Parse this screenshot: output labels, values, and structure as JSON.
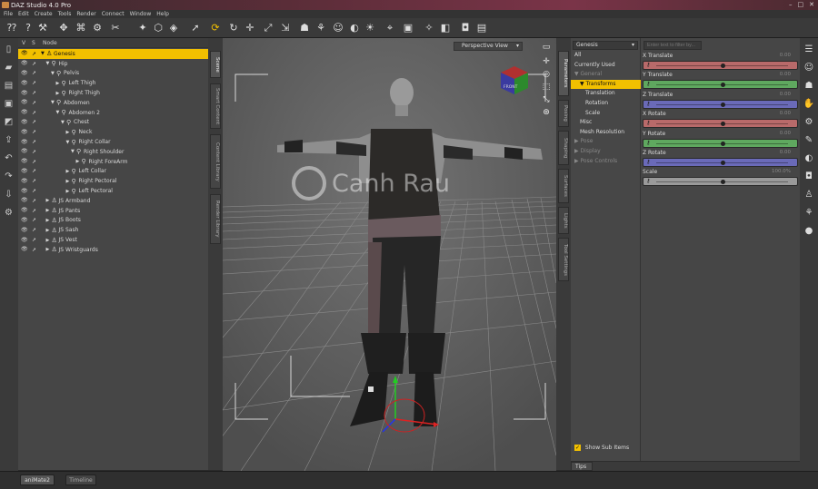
{
  "window": {
    "title": "DAZ Studio 4.0 Pro",
    "controls": [
      "–",
      "□",
      "✕"
    ]
  },
  "menu": [
    "File",
    "Edit",
    "Create",
    "Tools",
    "Render",
    "Connect",
    "Window",
    "Help"
  ],
  "scene": {
    "columns": {
      "v": "V",
      "s": "S",
      "node": "Node"
    },
    "tree": [
      {
        "label": "Genesis",
        "depth": 0,
        "selected": true,
        "type": "figure",
        "expanded": true
      },
      {
        "label": "Hip",
        "depth": 1,
        "type": "bone",
        "expanded": true
      },
      {
        "label": "Pelvis",
        "depth": 2,
        "type": "bone",
        "expanded": true
      },
      {
        "label": "Left Thigh",
        "depth": 3,
        "type": "bone",
        "expanded": false
      },
      {
        "label": "Right Thigh",
        "depth": 3,
        "type": "bone",
        "expanded": false
      },
      {
        "label": "Abdomen",
        "depth": 2,
        "type": "bone",
        "expanded": true
      },
      {
        "label": "Abdomen 2",
        "depth": 3,
        "type": "bone",
        "expanded": true
      },
      {
        "label": "Chest",
        "depth": 4,
        "type": "bone",
        "expanded": true
      },
      {
        "label": "Neck",
        "depth": 5,
        "type": "bone",
        "expanded": false
      },
      {
        "label": "Right Collar",
        "depth": 5,
        "type": "bone",
        "expanded": true
      },
      {
        "label": "Right Shoulder",
        "depth": 6,
        "type": "bone",
        "expanded": true
      },
      {
        "label": "Right ForeArm",
        "depth": 7,
        "type": "bone",
        "expanded": false
      },
      {
        "label": "Left Collar",
        "depth": 5,
        "type": "bone",
        "expanded": false
      },
      {
        "label": "Right Pectoral",
        "depth": 5,
        "type": "bone",
        "expanded": false
      },
      {
        "label": "Left Pectoral",
        "depth": 5,
        "type": "bone",
        "expanded": false
      },
      {
        "label": "JS Armband",
        "depth": 1,
        "type": "figure",
        "expanded": false
      },
      {
        "label": "JS Pants",
        "depth": 1,
        "type": "figure",
        "expanded": false
      },
      {
        "label": "JS Boots",
        "depth": 1,
        "type": "figure",
        "expanded": false
      },
      {
        "label": "JS Sash",
        "depth": 1,
        "type": "figure",
        "expanded": false
      },
      {
        "label": "JS Vest",
        "depth": 1,
        "type": "figure",
        "expanded": false
      },
      {
        "label": "JS Wristguards",
        "depth": 1,
        "type": "figure",
        "expanded": false
      }
    ]
  },
  "scene_tabs": [
    "Scene",
    "Smart Content",
    "Content Library",
    "Render Library"
  ],
  "viewport": {
    "camera": "Perspective View",
    "cube_label": "FRONT"
  },
  "param_tabs": [
    "Parameters",
    "Posing",
    "Shaping",
    "Surfaces",
    "Lights",
    "Tool Settings"
  ],
  "parameters": {
    "node_select": "Genesis",
    "filter_placeholder": "Enter text to filter by...",
    "tree": [
      {
        "label": "All",
        "indent": 0,
        "state": "normal"
      },
      {
        "label": "Currently Used",
        "indent": 0,
        "state": "normal"
      },
      {
        "label": "General",
        "indent": 0,
        "state": "dim",
        "arrow": "▼"
      },
      {
        "label": "Transforms",
        "indent": 1,
        "state": "selected",
        "arrow": "▼"
      },
      {
        "label": "Translation",
        "indent": 2,
        "state": "normal"
      },
      {
        "label": "Rotation",
        "indent": 2,
        "state": "normal"
      },
      {
        "label": "Scale",
        "indent": 2,
        "state": "normal"
      },
      {
        "label": "Misc",
        "indent": 1,
        "state": "normal"
      },
      {
        "label": "Mesh Resolution",
        "indent": 1,
        "state": "normal"
      },
      {
        "label": "Pose",
        "indent": 0,
        "state": "dim",
        "arrow": "▶"
      },
      {
        "label": "Display",
        "indent": 0,
        "state": "dim",
        "arrow": "▶"
      },
      {
        "label": "Pose Controls",
        "indent": 0,
        "state": "dim",
        "arrow": "▶"
      }
    ],
    "show_sub_items": "Show Sub Items",
    "sliders": [
      {
        "label": "X Translate",
        "value": "0.00",
        "color": "#b86a6a",
        "fill": 0.5
      },
      {
        "label": "Y Translate",
        "value": "0.00",
        "color": "#5fa85f",
        "fill": 0.5
      },
      {
        "label": "Z Translate",
        "value": "0.00",
        "color": "#6a6ab8",
        "fill": 0.5
      },
      {
        "label": "X Rotate",
        "value": "0.00",
        "color": "#b86a6a",
        "fill": 0.5
      },
      {
        "label": "Y Rotate",
        "value": "0.00",
        "color": "#5fa85f",
        "fill": 0.5
      },
      {
        "label": "Z Rotate",
        "value": "0.00",
        "color": "#6a6ab8",
        "fill": 0.5
      },
      {
        "label": "Scale",
        "value": "100.0%",
        "color": "#9a9a9a",
        "fill": 0.5
      }
    ],
    "tips": "Tips"
  },
  "bottom_tabs": [
    "aniMate2",
    "Timeline"
  ],
  "watermark": "Canh Rau"
}
